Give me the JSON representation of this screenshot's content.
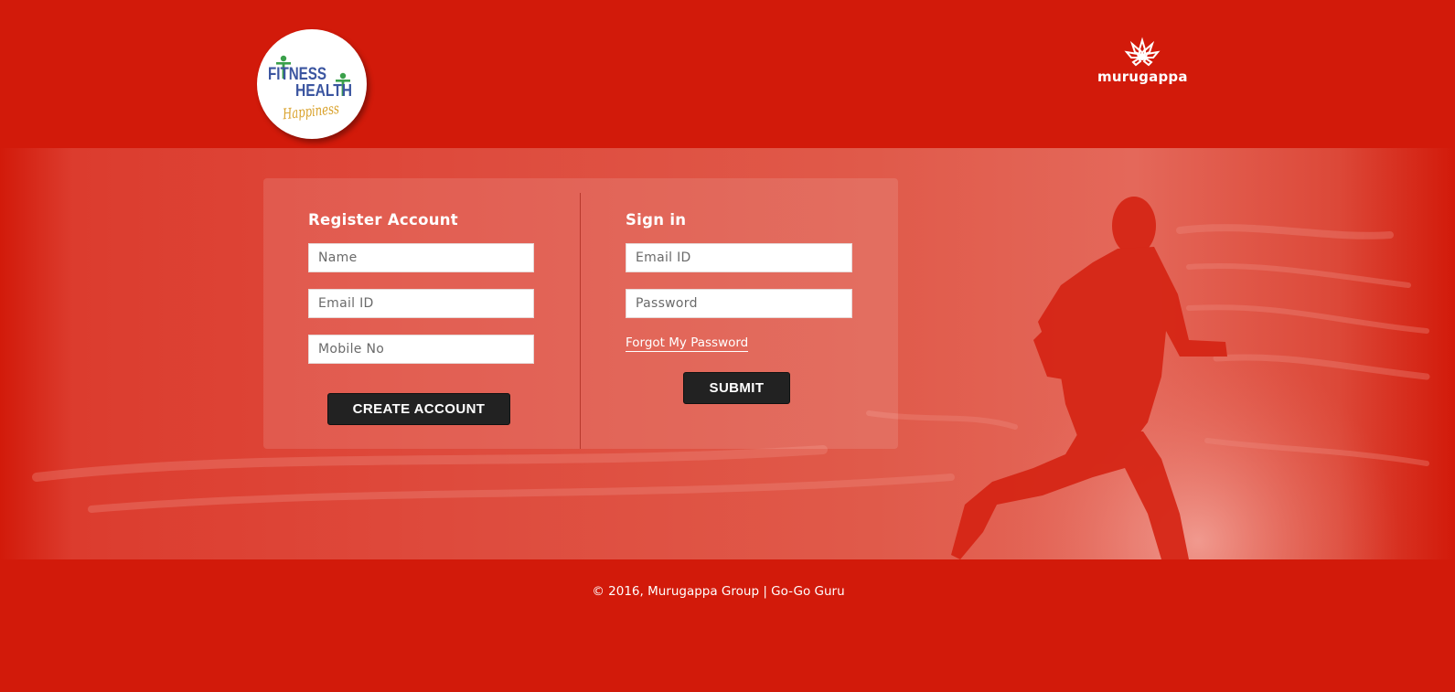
{
  "header": {
    "app_logo": {
      "line1": "FITNESS",
      "line2": "HEALTH",
      "line3": "Happiness"
    },
    "brand_logo": {
      "text": "murugappa"
    }
  },
  "register": {
    "title": "Register Account",
    "name_placeholder": "Name",
    "email_placeholder": "Email ID",
    "mobile_placeholder": "Mobile No",
    "button_label": "CREATE ACCOUNT"
  },
  "signin": {
    "title": "Sign in",
    "email_placeholder": "Email ID",
    "password_placeholder": "Password",
    "forgot_label": "Forgot My Password",
    "button_label": "SUBMIT"
  },
  "footer": {
    "text": "© 2016, Murugappa Group | Go-Go Guru"
  },
  "colors": {
    "background": "#d21a0a",
    "button": "#222222"
  }
}
